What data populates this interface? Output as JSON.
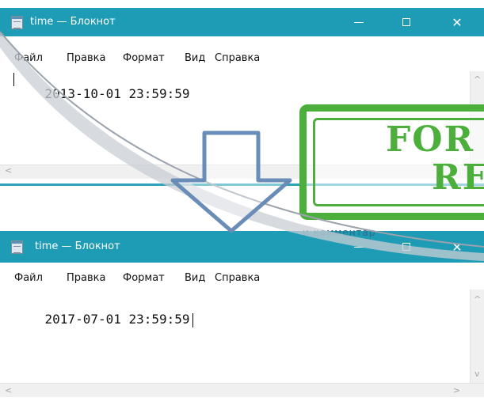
{
  "top_window": {
    "title": "time — Блокнот",
    "menu": [
      "Файл",
      "Правка",
      "Формат",
      "Вид",
      "Справка"
    ],
    "text": "2013-10-01 23:59:59"
  },
  "bottom_window": {
    "title": "time — Блокнот",
    "menu": [
      "Файл",
      "Правка",
      "Формат",
      "Вид",
      "Справка"
    ],
    "text": "2017-07-01 23:59:59"
  },
  "titlebar_buttons": {
    "minimize": "—",
    "maximize": "☐",
    "close": "✕"
  },
  "scroll_arrows": {
    "left": "<",
    "right": ">",
    "up": "^",
    "down": "v"
  },
  "watermark": {
    "line1": "FOR",
    "line2": "RE",
    "caption": "и комментар"
  },
  "colors": {
    "titlebar": "#1e9bb5",
    "stamp": "#4caf3c",
    "arrow": "#6a8db8"
  }
}
